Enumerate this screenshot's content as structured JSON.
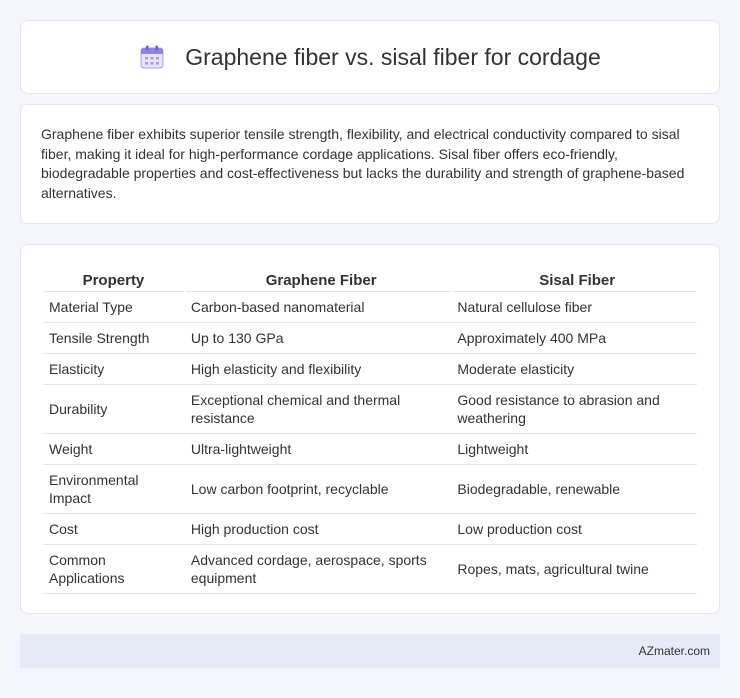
{
  "header": {
    "title": "Graphene fiber vs. sisal fiber for cordage",
    "icon": "calendar-icon"
  },
  "intro": {
    "text": "Graphene fiber exhibits superior tensile strength, flexibility, and electrical conductivity compared to sisal fiber, making it ideal for high-performance cordage applications. Sisal fiber offers eco-friendly, biodegradable properties and cost-effectiveness but lacks the durability and strength of graphene-based alternatives."
  },
  "table": {
    "headers": [
      "Property",
      "Graphene Fiber",
      "Sisal Fiber"
    ],
    "rows": [
      [
        "Material Type",
        "Carbon-based nanomaterial",
        "Natural cellulose fiber"
      ],
      [
        "Tensile Strength",
        "Up to 130 GPa",
        "Approximately 400 MPa"
      ],
      [
        "Elasticity",
        "High elasticity and flexibility",
        "Moderate elasticity"
      ],
      [
        "Durability",
        "Exceptional chemical and thermal resistance",
        "Good resistance to abrasion and weathering"
      ],
      [
        "Weight",
        "Ultra-lightweight",
        "Lightweight"
      ],
      [
        "Environmental Impact",
        "Low carbon footprint, recyclable",
        "Biodegradable, renewable"
      ],
      [
        "Cost",
        "High production cost",
        "Low production cost"
      ],
      [
        "Common Applications",
        "Advanced cordage, aerospace, sports equipment",
        "Ropes, mats, agricultural twine"
      ]
    ]
  },
  "footer": {
    "text": "AZmater.com"
  }
}
